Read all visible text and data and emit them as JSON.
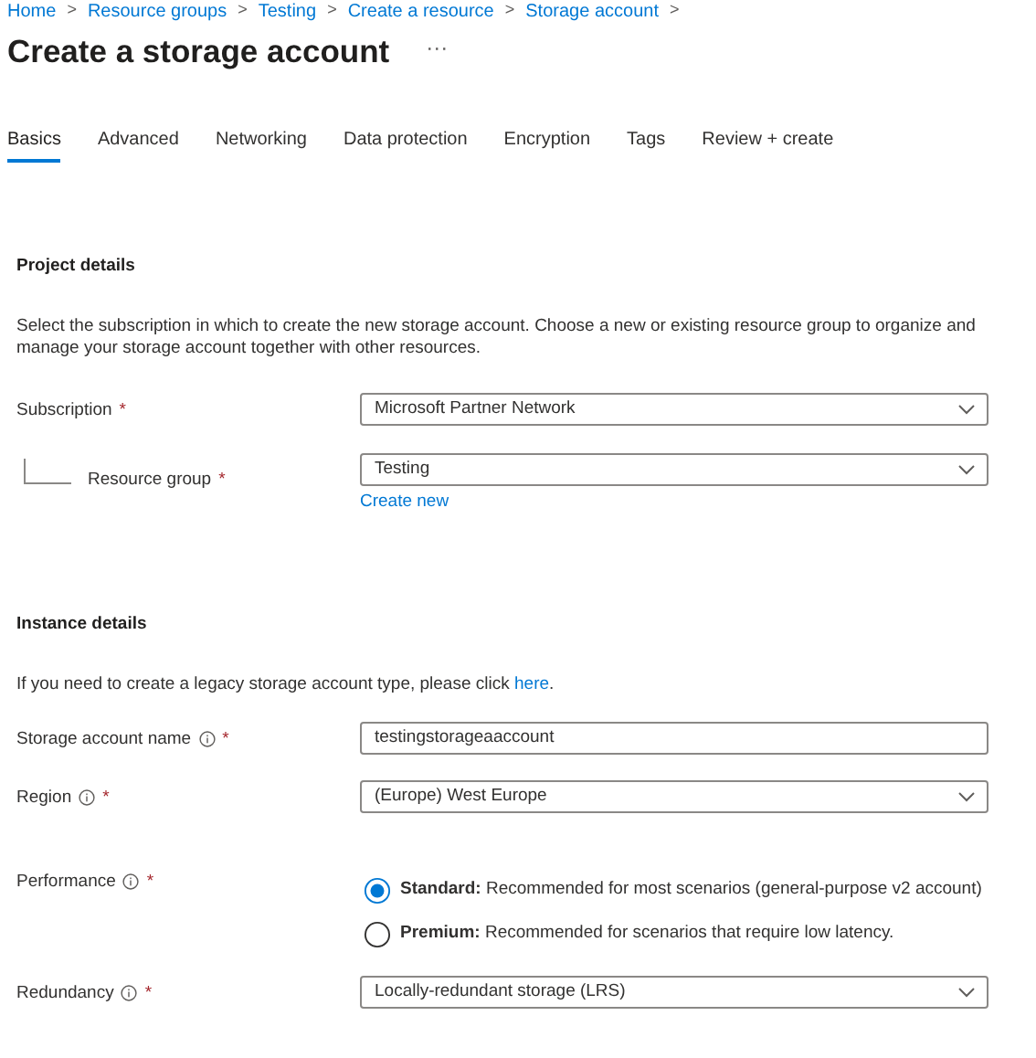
{
  "breadcrumb": [
    {
      "label": "Home",
      "separator": ">"
    },
    {
      "label": "Resource groups",
      "separator": ">"
    },
    {
      "label": "Testing",
      "separator": ">"
    },
    {
      "label": "Create a resource",
      "separator": ">"
    },
    {
      "label": "Storage account",
      "separator": ">"
    }
  ],
  "title": "Create a storage account",
  "more": "···",
  "tabs": [
    {
      "label": "Basics",
      "selected": true
    },
    {
      "label": "Advanced",
      "selected": false
    },
    {
      "label": "Networking",
      "selected": false
    },
    {
      "label": "Data protection",
      "selected": false
    },
    {
      "label": "Encryption",
      "selected": false
    },
    {
      "label": "Tags",
      "selected": false
    },
    {
      "label": "Review + create",
      "selected": false
    }
  ],
  "sections": [
    {
      "heading": "Project details",
      "description": {
        "text": "Select the subscription in which to create the new storage account. Choose a new or existing resource group to organize and manage your storage account together with other resources."
      },
      "fields": [
        {
          "kind": "select",
          "label": "Subscription",
          "required": "*",
          "info": false,
          "indented": false,
          "value": "Microsoft Partner Network"
        },
        {
          "kind": "select",
          "label": "Resource group",
          "required": "*",
          "info": false,
          "indented": true,
          "value": "Testing",
          "link": "Create new"
        }
      ]
    },
    {
      "heading": "Instance details",
      "description": {
        "text": "If you need to create a legacy storage account type, please click ",
        "link": "here",
        "after": "."
      },
      "fields": [
        {
          "kind": "text",
          "label": "Storage account name",
          "required": "*",
          "info": true,
          "indented": false,
          "value": "testingstorageaaccount"
        },
        {
          "kind": "select",
          "label": "Region",
          "required": "*",
          "info": true,
          "indented": false,
          "value": "(Europe) West Europe"
        },
        {
          "kind": "radio",
          "label": "Performance",
          "required": "*",
          "info": true,
          "indented": false,
          "options": [
            {
              "label": "**Standard:** Recommended for most scenarios (general-purpose v2 account)",
              "selected": true
            },
            {
              "label": "**Premium:** Recommended for scenarios that require low latency.",
              "selected": false
            }
          ]
        },
        {
          "kind": "select",
          "label": "Redundancy",
          "required": "*",
          "info": true,
          "indented": false,
          "value": "Locally-redundant storage (LRS)"
        }
      ]
    }
  ]
}
